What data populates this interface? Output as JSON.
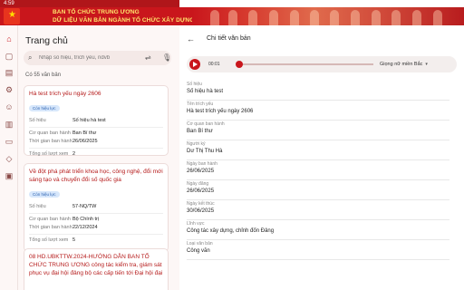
{
  "status_bar": {
    "time": "4:59",
    "battery": "▾ ▮"
  },
  "banner": {
    "line1": "BAN TỔ CHỨC TRUNG ƯƠNG",
    "line2": "DỮ LIỆU VĂN BẢN NGÀNH TỔ CHỨC XÂY DỰNG ĐẢNG"
  },
  "rail_icons": [
    "home-icon",
    "cube-icon",
    "document-icon",
    "people-settings-icon",
    "person-icon",
    "book-icon",
    "message-icon",
    "shield-icon",
    "docs-icon"
  ],
  "left": {
    "heading": "Trang chủ",
    "search_placeholder": "Nhập số hiệu, trích yếu, nđvb",
    "count": "Có 55 văn bản",
    "cards": [
      {
        "title": "Hà test trích yếu ngày 2606",
        "badge": "Còn hiệu lực",
        "rows": [
          {
            "k": "Số hiệu",
            "v": "Số hiệu hà test"
          },
          {
            "k": "Cơ quan ban hành",
            "v": "Ban Bí thư"
          },
          {
            "k": "Thời gian ban hành",
            "v": "26/06/2025"
          },
          {
            "k": "Tổng số lượt xem",
            "v": "2"
          }
        ]
      },
      {
        "title": "Về đột phá phát triển khoa học, công nghệ, đổi mới sáng tạo và chuyển đổi số quốc gia",
        "badge": "Còn hiệu lực",
        "rows": [
          {
            "k": "Số hiệu",
            "v": "57-NQ/TW"
          },
          {
            "k": "Cơ quan ban hành",
            "v": "Bộ Chính trị"
          },
          {
            "k": "Thời gian ban hành",
            "v": "22/12/2024"
          },
          {
            "k": "Tổng số lượt xem",
            "v": "5"
          }
        ]
      },
      {
        "title": "08 HD.UBKTTW.2024-HƯỚNG DẪN BAN TỔ CHỨC TRUNG ƯƠNG công tác kiểm tra, giám sát phục vụ đại hội đảng bộ các cấp tiến tới Đại hội đại",
        "badge": "",
        "rows": []
      }
    ]
  },
  "right": {
    "title": "Chi tiết văn bản",
    "player": {
      "time": "00:01",
      "voice": "Giọng nữ miền Bắc"
    },
    "fields": [
      {
        "label": "Số hiệu",
        "value": "Số hiệu hà test"
      },
      {
        "label": "Tên trích yếu",
        "value": "Hà test trích yếu ngày 2606"
      },
      {
        "label": "Cơ quan ban hành",
        "value": "Ban Bí thư"
      },
      {
        "label": "Người ký",
        "value": "Dư Thị Thu Hà"
      },
      {
        "label": "Ngày ban hành",
        "value": "26/06/2025"
      },
      {
        "label": "Ngày đăng",
        "value": "26/06/2025"
      },
      {
        "label": "Ngày kết thúc",
        "value": "30/06/2025"
      },
      {
        "label": "Lĩnh vực",
        "value": "Công tác xây dựng, chỉnh đốn Đảng"
      },
      {
        "label": "Loại văn bản",
        "value": "Công văn"
      }
    ]
  }
}
